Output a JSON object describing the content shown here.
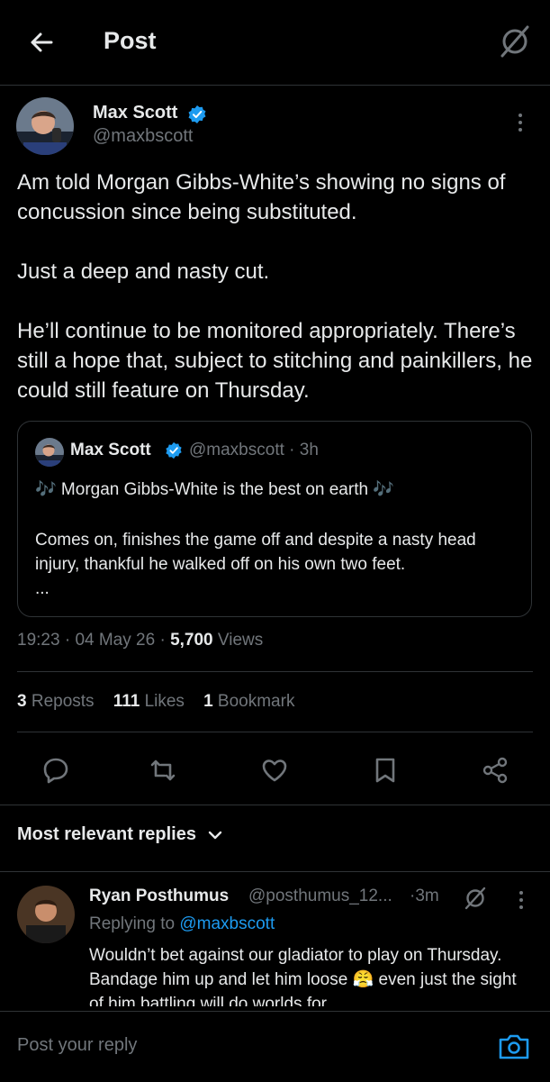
{
  "header": {
    "title": "Post"
  },
  "main_tweet": {
    "author_name": "Max Scott",
    "author_handle": "@maxbscott",
    "text": "Am told Morgan Gibbs-White’s showing no signs of concussion since being substituted.\n\nJust a deep and nasty cut.\n\nHe’ll continue to be monitored appropriately. There’s still a hope that, subject to stitching and painkillers, he could still feature on Thursday.",
    "time": "19:23",
    "date": "04 May 26",
    "views_count": "5,700",
    "views_label": "Views",
    "sep": "·"
  },
  "quote": {
    "author_name": "Max Scott",
    "author_handle": "@maxbscott",
    "time": "· 3h",
    "line1": "🎶 Morgan Gibbs-White is the best on earth 🎶",
    "body": "Comes on, finishes the game off and despite a nasty head injury, thankful he walked off on his own two feet.\n..."
  },
  "stats": {
    "reposts_count": "3",
    "reposts_label": "Reposts",
    "likes_count": "111",
    "likes_label": "Likes",
    "bookmarks_count": "1",
    "bookmarks_label": "Bookmark"
  },
  "replies": {
    "sort_label": "Most relevant replies",
    "items": [
      {
        "author_name": "Ryan Posthumus",
        "author_handle": "@posthumus_12...",
        "time": "·3m",
        "replying_prefix": "Replying to",
        "replying_handle": "@maxbscott",
        "text": "Wouldn’t bet against our gladiator to play on Thursday. Bandage him up and let him loose 😤 even just the sight of him battling will do worlds for"
      }
    ]
  },
  "compose": {
    "placeholder": "Post your reply"
  },
  "colors": {
    "background": "#000000",
    "text": "#e7e9ea",
    "muted": "#71767b",
    "accent": "#1d9bf0",
    "divider": "#2f3336"
  },
  "icons": {
    "back": "arrow-left-icon",
    "grok": "grok-icon",
    "more": "more-vertical-icon",
    "verified": "verified-badge-icon",
    "reply": "reply-icon",
    "repost": "repost-icon",
    "like": "heart-icon",
    "bookmark": "bookmark-icon",
    "share": "share-icon",
    "chevron": "chevron-down-icon",
    "camera": "camera-icon"
  }
}
